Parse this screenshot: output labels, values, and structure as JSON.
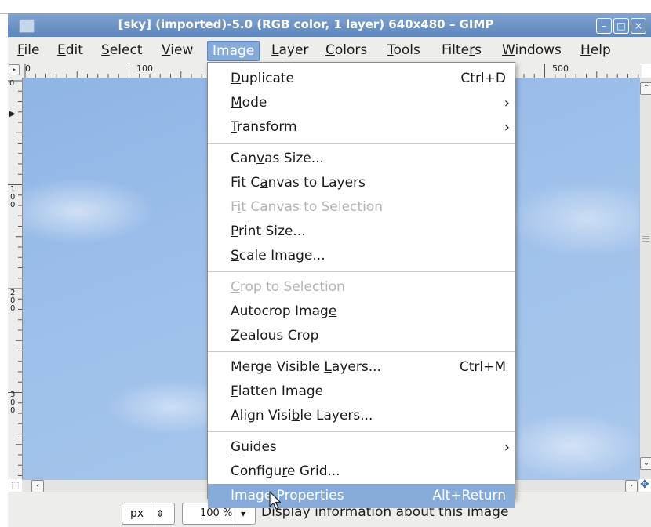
{
  "window": {
    "title": "[sky] (imported)-5.0 (RGB color, 1 layer) 640x480 – GIMP"
  },
  "menubar": {
    "items": [
      {
        "label": "File",
        "mnemonic": "F"
      },
      {
        "label": "Edit",
        "mnemonic": "E"
      },
      {
        "label": "Select",
        "mnemonic": "S"
      },
      {
        "label": "View",
        "mnemonic": "V"
      },
      {
        "label": "Image",
        "mnemonic": "I",
        "active": true
      },
      {
        "label": "Layer",
        "mnemonic": "L"
      },
      {
        "label": "Colors",
        "mnemonic": "C"
      },
      {
        "label": "Tools",
        "mnemonic": "T"
      },
      {
        "label": "Filters",
        "mnemonic": "r"
      },
      {
        "label": "Windows",
        "mnemonic": "W"
      },
      {
        "label": "Help",
        "mnemonic": "H"
      }
    ]
  },
  "rulers": {
    "horizontal": [
      "0",
      "100",
      "500"
    ],
    "vertical": [
      "0",
      "100",
      "200",
      "300"
    ]
  },
  "image_menu": {
    "groups": [
      [
        {
          "label": "Duplicate",
          "shortcut": "Ctrl+D",
          "mnemonic": "D"
        },
        {
          "label": "Mode",
          "submenu": true,
          "mnemonic": "M"
        },
        {
          "label": "Transform",
          "submenu": true,
          "mnemonic": "T"
        }
      ],
      [
        {
          "label": "Canvas Size...",
          "mnemonic": "v"
        },
        {
          "label": "Fit Canvas to Layers",
          "mnemonic": "a"
        },
        {
          "label": "Fit Canvas to Selection",
          "disabled": true,
          "mnemonic": "i"
        },
        {
          "label": "Print Size...",
          "mnemonic": "P"
        },
        {
          "label": "Scale Image...",
          "mnemonic": "S"
        }
      ],
      [
        {
          "label": "Crop to Selection",
          "disabled": true,
          "mnemonic": "C"
        },
        {
          "label": "Autocrop Image",
          "mnemonic": "e"
        },
        {
          "label": "Zealous Crop",
          "mnemonic": "Z"
        }
      ],
      [
        {
          "label": "Merge Visible Layers...",
          "shortcut": "Ctrl+M",
          "mnemonic": "L"
        },
        {
          "label": "Flatten Image",
          "mnemonic": "F"
        },
        {
          "label": "Align Visible Layers...",
          "mnemonic": "b"
        }
      ],
      [
        {
          "label": "Guides",
          "submenu": true,
          "mnemonic": "G"
        },
        {
          "label": "Configure Grid...",
          "mnemonic": "r"
        },
        {
          "label": "Image Properties",
          "shortcut": "Alt+Return",
          "highlighted": true
        }
      ]
    ]
  },
  "statusbar": {
    "unit": "px",
    "zoom": "100 %",
    "message": "Display information about this image"
  },
  "colors": {
    "title_bar": "#6a90c6",
    "menu_highlight": "#86abd9",
    "disabled_text": "#b4b4b4"
  }
}
